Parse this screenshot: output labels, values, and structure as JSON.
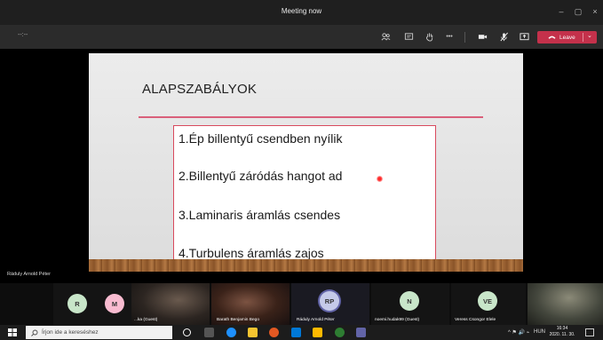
{
  "window": {
    "title": "Meeting now",
    "minimize_glyph": "–",
    "maximize_glyph": "▢",
    "close_glyph": "×"
  },
  "toolbar": {
    "timer": "--:--",
    "buttons": [
      "people-icon",
      "chat-icon",
      "raise-hand-icon",
      "more-options-icon",
      "camera-icon",
      "mic-muted-icon",
      "share-screen-icon"
    ],
    "more_glyph": "•••",
    "leave_label": "Leave",
    "leave_caret": "⌄",
    "leave_color": "#c4314b"
  },
  "slide": {
    "title": "ALAPSZABÁLYOK",
    "accent_color": "#d9607a",
    "points": [
      "1.Ép billentyű csendben nyílik",
      "2.Billentyű záródás hangot ad",
      "3.Laminaris áramlás csendes",
      "4.Turbulens áramlás zajos"
    ]
  },
  "presenter_name": "Ráduly Arnold Péter",
  "participants": [
    {
      "initials": "R",
      "name": "",
      "type": "avatar",
      "color": "#c8e6c9"
    },
    {
      "initials": "M",
      "name": "",
      "type": "avatar",
      "color": "#f8bbd0"
    },
    {
      "initials": "",
      "name": "...ka (Guest)",
      "type": "video"
    },
    {
      "initials": "",
      "name": "Barath Benjamin Bego",
      "type": "video"
    },
    {
      "initials": "RP",
      "name": "Ráduly Arnold Péter",
      "type": "avatar",
      "color": "#c5cae9"
    },
    {
      "initials": "N",
      "name": "noemi.hudak99 (Guest)",
      "type": "avatar",
      "color": "#c8e6c9"
    },
    {
      "initials": "VE",
      "name": "Veress Csongor Elele",
      "type": "avatar",
      "color": "#c8e6c9"
    },
    {
      "initials": "",
      "name": "",
      "type": "video"
    }
  ],
  "taskbar": {
    "search_placeholder": "Írjon ide a kereséshez",
    "language": "HUN",
    "time": "16:34",
    "date": "2020. 11. 30.",
    "tray_glyphs": "^ ⚑ 🔊 ⌁"
  }
}
